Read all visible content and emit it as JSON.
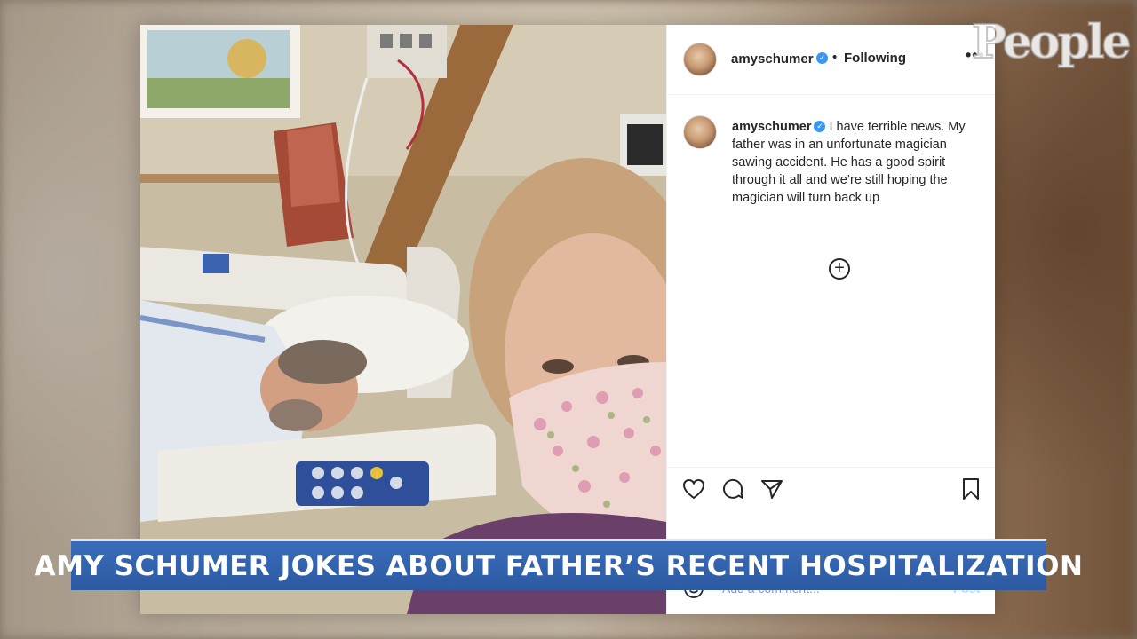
{
  "logo": {
    "text": "People"
  },
  "post": {
    "header": {
      "username": "amyschumer",
      "verified_glyph": "✓",
      "separator": "•",
      "follow_status": "Following",
      "more_glyph": "•••"
    },
    "caption": {
      "username": "amyschumer",
      "text": "I have terrible news. My father was in an unfortunate magician sawing accident. He has a good spirit through it all and we’re still hoping the magician will turn back up"
    },
    "load_more_glyph": "+",
    "actions": {
      "icons": [
        "heart-icon",
        "comment-icon",
        "share-icon",
        "bookmark-icon"
      ]
    },
    "comment": {
      "placeholder": "Add a comment...",
      "post_label": "Post"
    }
  },
  "banner": {
    "text": "AMY SCHUMER JOKES ABOUT FATHER’S RECENT HOSPITALIZATION"
  },
  "colors": {
    "banner_blue": "#2f5fa8",
    "verified_blue": "#3897f0",
    "post_button": "#b2dffc"
  }
}
